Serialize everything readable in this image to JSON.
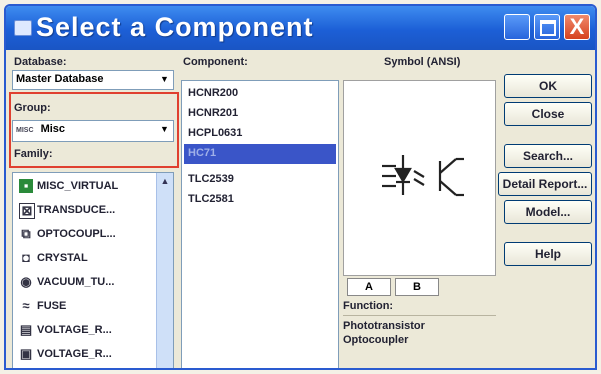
{
  "window": {
    "title": "Select a Component"
  },
  "title_buttons": {
    "close": "X"
  },
  "database": {
    "label": "Database:",
    "value": "Master Database"
  },
  "group": {
    "label": "Group:",
    "value": "Misc",
    "icon_text": "MISC"
  },
  "family": {
    "label": "Family:",
    "items": [
      {
        "label": "MISC_VIRTUAL",
        "icon": "misc-virtual-icon"
      },
      {
        "label": "TRANSDUCE...",
        "icon": "transducer-icon"
      },
      {
        "label": "OPTOCOUPL...",
        "icon": "optocoupler-icon"
      },
      {
        "label": "CRYSTAL",
        "icon": "crystal-icon"
      },
      {
        "label": "VACUUM_TU...",
        "icon": "vacuum-tube-icon"
      },
      {
        "label": "FUSE",
        "icon": "fuse-icon"
      },
      {
        "label": "VOLTAGE_R...",
        "icon": "voltage-regulator-icon"
      },
      {
        "label": "VOLTAGE_R...",
        "icon": "voltage-reference-icon"
      }
    ]
  },
  "component": {
    "label": "Component:",
    "items": [
      "HCNR200",
      "HCNR201",
      "HCPL0631",
      "HC71",
      "TLC2539",
      "TLC2581"
    ],
    "selected_index": 3
  },
  "symbol": {
    "label": "Symbol (ANSI)"
  },
  "buttons": [
    "OK",
    "Close",
    "Search...",
    "Detail Report...",
    "Model...",
    "Help"
  ],
  "tabs": [
    "A",
    "B"
  ],
  "function": {
    "label": "Function:",
    "lines": [
      "Phototransistor",
      "Optocoupler"
    ]
  },
  "colors": {
    "title_bar": "#1c5fd6",
    "selection": "#3a55c8",
    "highlight_box": "#e04030"
  }
}
